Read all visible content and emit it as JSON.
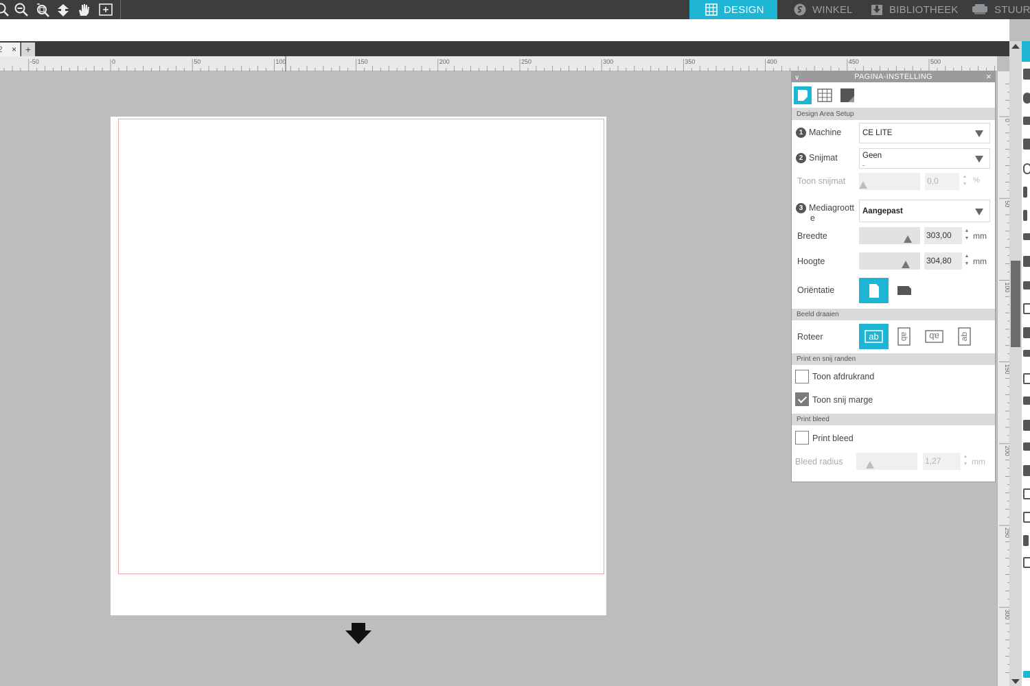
{
  "nav_tabs": [
    {
      "label": "DESIGN",
      "icon": "grid-icon",
      "active": true
    },
    {
      "label": "WINKEL",
      "icon": "store-icon",
      "active": false
    },
    {
      "label": "BIBLIOTHEEK",
      "icon": "library-icon",
      "active": false
    },
    {
      "label": "STUUR",
      "icon": "cutter-icon",
      "active": false
    }
  ],
  "toolbar_icons": [
    "zoom-in-icon",
    "zoom-out-icon",
    "zoom-fit-icon",
    "move-down-icon",
    "pan-hand-icon",
    "zoom-page-icon"
  ],
  "doc_tabs": {
    "current": "2",
    "close": "×",
    "add": "+"
  },
  "ruler_labels": [
    "-50",
    "0",
    "50",
    "100",
    "150",
    "200",
    "250",
    "300",
    "350",
    "400",
    "450",
    "500"
  ],
  "vruler_labels": [
    "0",
    "50",
    "100",
    "150",
    "200",
    "250",
    "300"
  ],
  "accent_color": "#1fb6d6",
  "panel": {
    "title": "PAGINA-INSTELLING",
    "tabs": [
      "page-setup-icon",
      "grid-setup-icon",
      "background-icon"
    ],
    "sections": {
      "design_area": "Design Area Setup",
      "beeld_draaien": "Beeld draaien",
      "print_snij": "Print en snij randen",
      "print_bleed": "Print bleed"
    },
    "machine": {
      "num": "1",
      "label": "Machine",
      "value": "CE LITE"
    },
    "snijmat": {
      "num": "2",
      "label": "Snijmat",
      "value": "Geen",
      "value_sub": "-"
    },
    "toon_snijmat": {
      "label": "Toon snijmat",
      "value": "0,0",
      "unit": "%",
      "level": 0.0
    },
    "mediagrootte": {
      "num": "3",
      "label": "Mediagroott",
      "label_wrap": "e",
      "value": "Aangepast"
    },
    "breedte": {
      "label": "Breedte",
      "value": "303,00",
      "unit": "mm"
    },
    "hoogte": {
      "label": "Hoogte",
      "value": "304,80",
      "unit": "mm"
    },
    "orientatie": {
      "label": "Oriëntatie",
      "selected": "portrait"
    },
    "roteer": {
      "label": "Roteer",
      "selected": 0
    },
    "toon_afdrukrand": {
      "label": "Toon afdrukrand",
      "checked": false
    },
    "toon_snij_marge": {
      "label": "Toon snij marge",
      "checked": true
    },
    "print_bleed": {
      "label": "Print bleed",
      "checked": false
    },
    "bleed_radius": {
      "label": "Bleed radius",
      "value": "1,27",
      "unit": "mm"
    },
    "spin_up": "▲",
    "spin_down": "▼"
  }
}
